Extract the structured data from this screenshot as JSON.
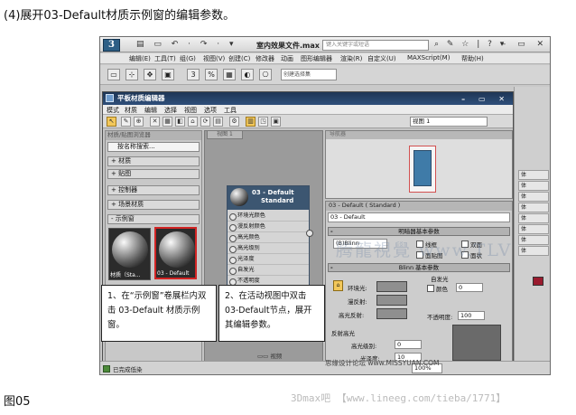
{
  "caption": "(4)展开03-Default材质示例窗的编辑参数。",
  "figure_label": "图05",
  "credit": "3Dmax吧 【www.lineeg.com/tieba/1771】",
  "watermark": {
    "top": "腾龍視覺   www.TLVI.NET",
    "site": "思缘设计论坛  www.MISSYUAN.COM"
  },
  "max": {
    "logo": "3",
    "quick_access": "▤ ▭ ↶ · ↷ · ▾",
    "title": "室内效果文件.max",
    "search_placeholder": "键入关键字或短语",
    "title_icons": "⌕ ✎ ☆ | ? ▾",
    "window_buttons": "– ▭ ✕",
    "menus": [
      "编辑(E)",
      "工具(T)",
      "组(G)",
      "视图(V)",
      "创建(C)",
      "修改器",
      "动画",
      "图形编辑器",
      "渲染(R)",
      "自定义(U)",
      "MAXScript(M)",
      "帮助(H)"
    ],
    "toolbar_icons": [
      "▭",
      "⊹",
      "✥",
      "▣",
      "3",
      "%",
      "▦",
      "◐",
      "⎔"
    ],
    "toolbar_select": "创建选择集",
    "command_panel": [
      "体",
      "体",
      "体",
      "体",
      "体",
      "体",
      "体",
      "体"
    ],
    "status_text": "已完成低染",
    "zoom": "100%"
  },
  "sme": {
    "title": "平板材质编辑器",
    "window_buttons": "– ▭ ✕",
    "menus": [
      "模式",
      "材质",
      "编辑",
      "选择",
      "视图",
      "选项",
      "工具"
    ],
    "toolbar_icons": [
      "↖",
      "✎",
      "⊕",
      "✕",
      "▦",
      "◧",
      "⌂",
      "⟳",
      "▤",
      "⚙",
      "▥",
      "◳",
      "▣"
    ],
    "view_select": "视图 1",
    "browser": {
      "header": "材质/贴图浏览器",
      "search": "按名称搜索...",
      "rows": [
        "+ 材质",
        "+ 贴图",
        "+ 控制器",
        "+ 场景材质",
        "- 示例窗"
      ],
      "slots": [
        "材质（Sta...",
        "03 - Default"
      ]
    },
    "view": {
      "tab": "视图 1",
      "bottom": "▭▭ 视频"
    },
    "node": {
      "title_line1": "03 - Default",
      "title_line2": "Standard",
      "slots": [
        "环境光颜色",
        "漫反射颜色",
        "高光颜色",
        "高光级别",
        "光泽度",
        "自发光",
        "不透明度"
      ]
    },
    "navigator": {
      "header": "导航器"
    },
    "params": {
      "header": "03 - Default  ( Standard )",
      "name": "03 - Default",
      "rollout1": "明暗器基本参数",
      "shader": "(B)Blinn",
      "checks": [
        "线框",
        "双面",
        "面贴图",
        "面状"
      ],
      "rollout2": "Blinn 基本参数",
      "self_illum": "自发光",
      "color_label": "颜色",
      "color_value": "0",
      "ambient": "环境光:",
      "diffuse": "漫反射:",
      "specular": "高光反射:",
      "opacity_label": "不透明度:",
      "opacity_value": "100",
      "spec_highlights": "反射高光",
      "spec_level_label": "高光级别:",
      "spec_level_value": "0",
      "glossiness_label": "光泽度:",
      "glossiness_value": "10"
    }
  },
  "callouts": {
    "c1": "1、在“示例窗”卷展栏内双击 03-Default 材质示例窗。",
    "c2": "2、在活动视图中双击03-Default节点，展开其编辑参数。"
  }
}
